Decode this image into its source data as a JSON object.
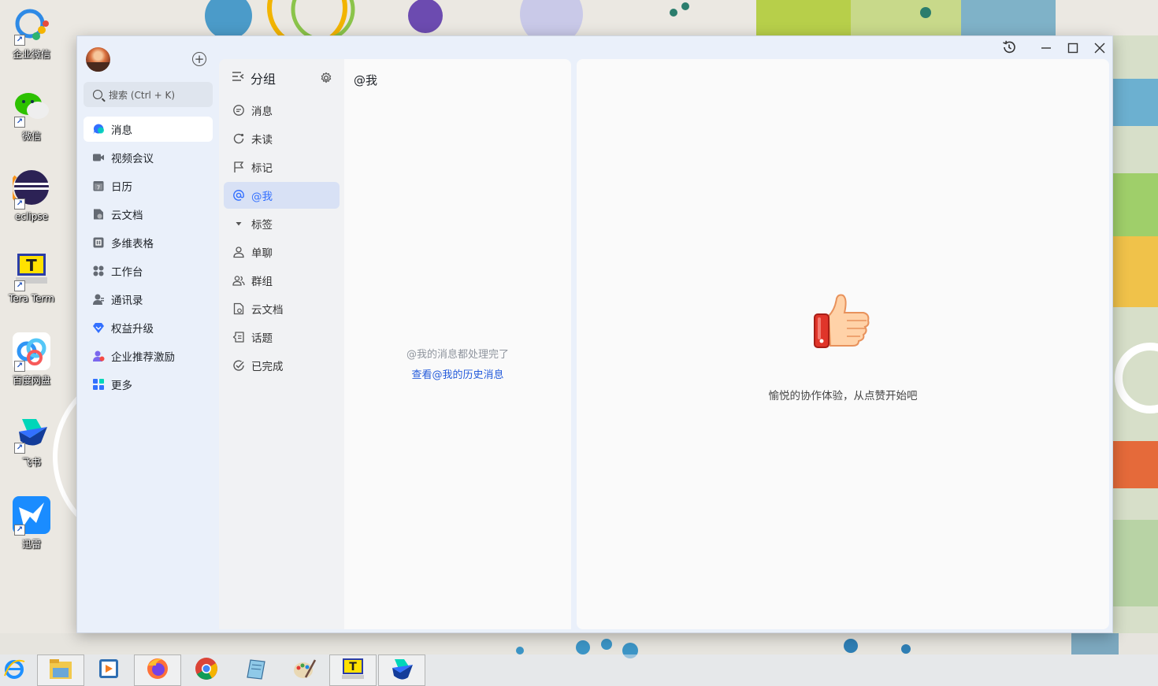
{
  "desktop": {
    "icons": [
      {
        "label": "企业微信",
        "icon": "wecom-icon"
      },
      {
        "label": "微信",
        "icon": "wechat-icon"
      },
      {
        "label": "eclipse",
        "icon": "eclipse-icon"
      },
      {
        "label": "Tera Term",
        "icon": "teraterm-icon"
      },
      {
        "label": "百度网盘",
        "icon": "baidu-netdisk-icon"
      },
      {
        "label": "飞书",
        "icon": "feishu-icon"
      },
      {
        "label": "迅雷",
        "icon": "xunlei-icon"
      }
    ]
  },
  "app": {
    "search_placeholder": "搜索 (Ctrl + K)",
    "nav": [
      {
        "label": "消息",
        "icon": "message-icon",
        "color": "#3370ff"
      },
      {
        "label": "视频会议",
        "icon": "video-icon",
        "color": "#646a73"
      },
      {
        "label": "日历",
        "icon": "calendar-icon",
        "color": "#646a73"
      },
      {
        "label": "云文档",
        "icon": "cloud-doc-icon",
        "color": "#646a73"
      },
      {
        "label": "多维表格",
        "icon": "bitable-icon",
        "color": "#646a73"
      },
      {
        "label": "工作台",
        "icon": "workplace-icon",
        "color": "#646a73"
      },
      {
        "label": "通讯录",
        "icon": "contacts-icon",
        "color": "#646a73"
      },
      {
        "label": "权益升级",
        "icon": "diamond-icon",
        "color": "#3370ff"
      },
      {
        "label": "企业推荐激励",
        "icon": "referral-icon",
        "color": "#7b67ee"
      },
      {
        "label": "更多",
        "icon": "more-apps-icon",
        "color": "#3370ff"
      }
    ],
    "groups": {
      "title": "分组",
      "items": [
        {
          "label": "消息",
          "icon": "chat-bubble-icon"
        },
        {
          "label": "未读",
          "icon": "unread-icon"
        },
        {
          "label": "标记",
          "icon": "flag-icon"
        },
        {
          "label": "@我",
          "icon": "at-icon",
          "active": true
        },
        {
          "label": "标签",
          "icon": "caret-down-icon"
        },
        {
          "label": "单聊",
          "icon": "user-icon"
        },
        {
          "label": "群组",
          "icon": "group-icon"
        },
        {
          "label": "云文档",
          "icon": "doc-icon"
        },
        {
          "label": "话题",
          "icon": "topic-icon"
        },
        {
          "label": "已完成",
          "icon": "done-icon"
        }
      ]
    },
    "message_list": {
      "header": "@我",
      "empty_text": "@我的消息都处理完了",
      "history_link": "查看@我的历史消息"
    },
    "content": {
      "tip": "愉悦的协作体验，从点赞开始吧"
    }
  },
  "taskbar": {
    "items": [
      {
        "icon": "ie-icon",
        "open": false
      },
      {
        "icon": "file-explorer-icon",
        "open": true
      },
      {
        "icon": "media-player-icon",
        "open": false
      },
      {
        "icon": "firefox-icon",
        "open": true
      },
      {
        "icon": "chrome-icon",
        "open": false
      },
      {
        "icon": "notepad-icon",
        "open": false
      },
      {
        "icon": "paint-icon",
        "open": false
      },
      {
        "icon": "teraterm-icon",
        "open": true
      },
      {
        "icon": "feishu-icon",
        "open": true
      }
    ]
  }
}
